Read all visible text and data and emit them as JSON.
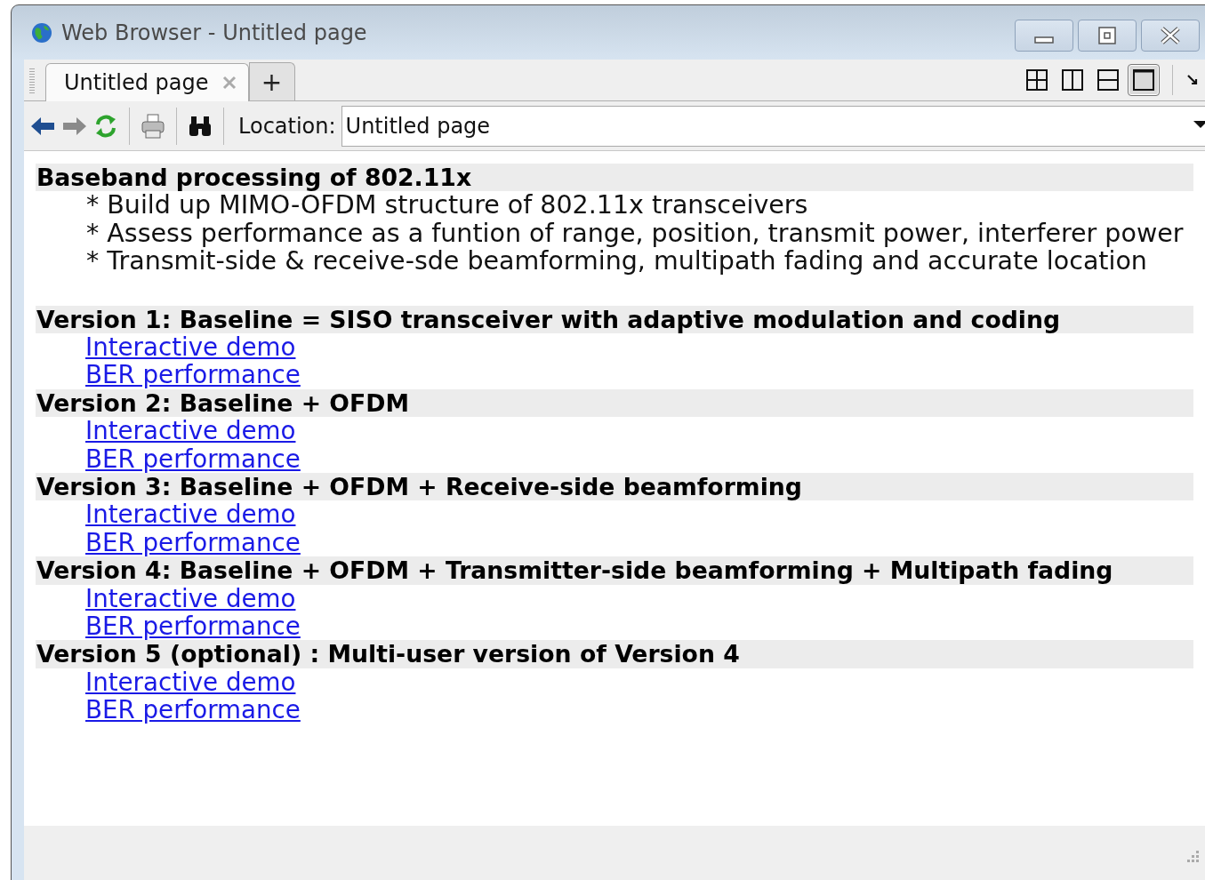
{
  "window": {
    "title": "Web Browser - Untitled page"
  },
  "tabs": [
    {
      "label": "Untitled page",
      "selected": true
    }
  ],
  "new_tab": "+",
  "layout_buttons": [
    {
      "kind": "grid",
      "selected": false
    },
    {
      "kind": "columns",
      "selected": false
    },
    {
      "kind": "rows",
      "selected": false
    },
    {
      "kind": "single",
      "selected": true
    }
  ],
  "location": {
    "label": "Location:",
    "value": "Untitled page"
  },
  "content": {
    "heading": "Baseband processing of 802.11x",
    "bullets": [
      "* Build up MIMO-OFDM structure of 802.11x transceivers",
      "* Assess performance as a funtion of range, position, transmit power, interferer power",
      "* Transmit-side & receive-sde beamforming, multipath fading and accurate location"
    ],
    "versions": [
      {
        "title": "Version 1: Baseline = SISO transceiver with adaptive modulation and coding",
        "links": [
          "Interactive demo",
          "BER performance"
        ]
      },
      {
        "title": "Version 2: Baseline + OFDM",
        "links": [
          "Interactive demo",
          "BER performance"
        ]
      },
      {
        "title": "Version 3: Baseline + OFDM + Receive-side beamforming",
        "links": [
          "Interactive demo",
          "BER performance"
        ]
      },
      {
        "title": "Version 4: Baseline + OFDM + Transmitter-side beamforming + Multipath fading",
        "links": [
          "Interactive demo",
          "BER performance"
        ]
      },
      {
        "title": "Version 5 (optional) : Multi-user version of Version 4",
        "links": [
          "Interactive demo",
          "BER performance"
        ]
      }
    ]
  }
}
